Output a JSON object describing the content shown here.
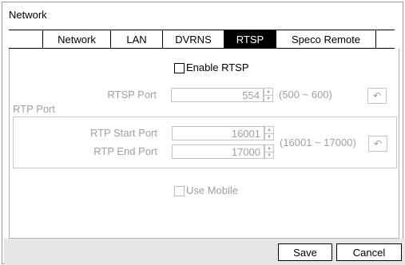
{
  "window": {
    "title": "Network"
  },
  "tabs": [
    {
      "label": "Network",
      "active": false
    },
    {
      "label": "LAN",
      "active": false
    },
    {
      "label": "DVRNS",
      "active": false
    },
    {
      "label": "RTSP",
      "active": true
    },
    {
      "label": "Speco Remote",
      "active": false
    }
  ],
  "rtsp": {
    "enable_label": "Enable RTSP",
    "enable_checked": false,
    "port_label": "RTSP Port",
    "port_value": "554",
    "port_range": "(500 ~ 600)"
  },
  "rtp": {
    "group_label": "RTP Port",
    "start_label": "RTP Start Port",
    "start_value": "16001",
    "end_label": "RTP End Port",
    "end_value": "17000",
    "range": "(16001 ~ 17000)"
  },
  "mobile": {
    "label": "Use Mobile",
    "checked": false
  },
  "footer": {
    "save_label": "Save",
    "cancel_label": "Cancel"
  },
  "icons": {
    "reset": "undo-arrow-icon",
    "spin": "spinner-arrows-icon"
  }
}
